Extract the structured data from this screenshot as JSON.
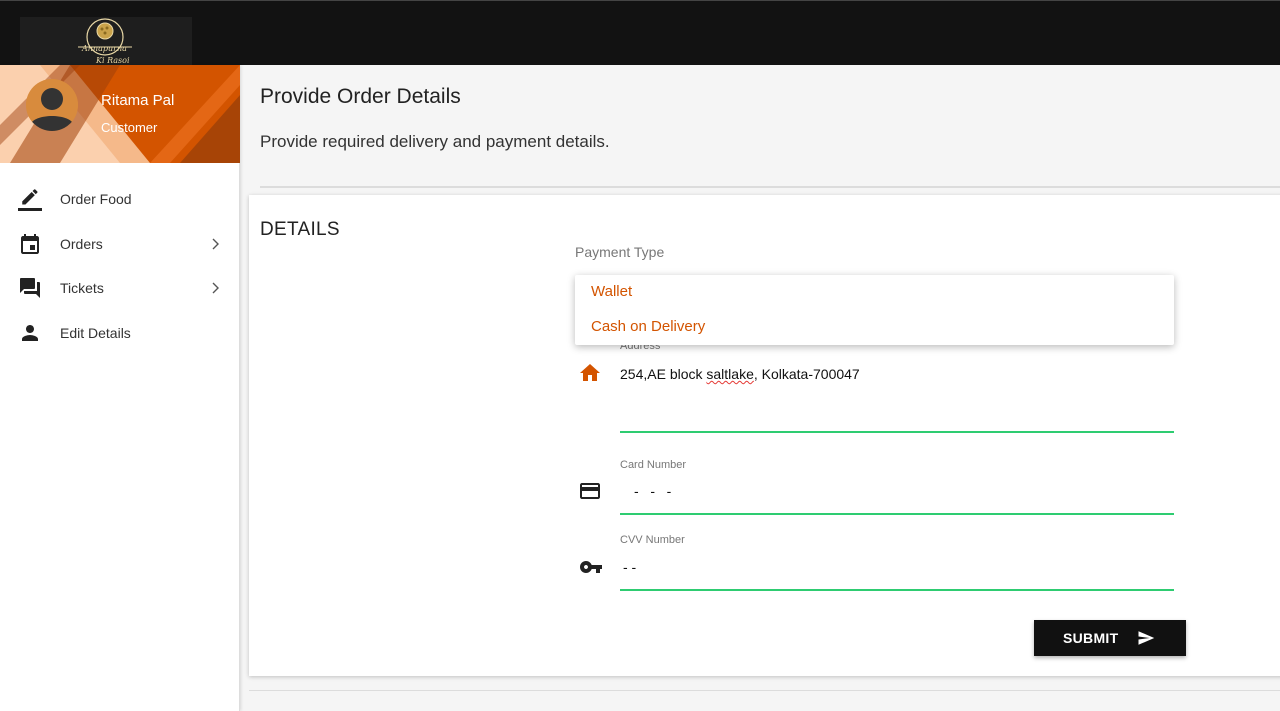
{
  "logo": {
    "line1": "Annapurna",
    "line2": "Ki Rasoi"
  },
  "profile": {
    "name": "Ritama Pal",
    "role": "Customer"
  },
  "nav": [
    {
      "label": "Order Food",
      "icon": "pencil-icon",
      "has_chevron": false
    },
    {
      "label": "Orders",
      "icon": "calendar-icon",
      "has_chevron": true
    },
    {
      "label": "Tickets",
      "icon": "forum-icon",
      "has_chevron": true
    },
    {
      "label": "Edit Details",
      "icon": "person-icon",
      "has_chevron": false
    }
  ],
  "page": {
    "title": "Provide Order Details",
    "subtitle": "Provide required delivery and payment details."
  },
  "details": {
    "title": "DETAILS",
    "payment_type_label": "Payment Type",
    "payment_options": [
      "Wallet",
      "Cash on Delivery"
    ],
    "address": {
      "label": "Address",
      "value_part1": "254,AE block ",
      "value_misspelled": "saltlake",
      "value_part2": ", Kolkata-700047"
    },
    "card_number": {
      "label": "Card Number",
      "value": "-   -   -"
    },
    "cvv": {
      "label": "CVV Number",
      "value": "- -"
    },
    "submit_label": "SUBMIT"
  },
  "colors": {
    "accent": "#d35400",
    "underline": "#2ecc71",
    "topbar": "#121212"
  }
}
